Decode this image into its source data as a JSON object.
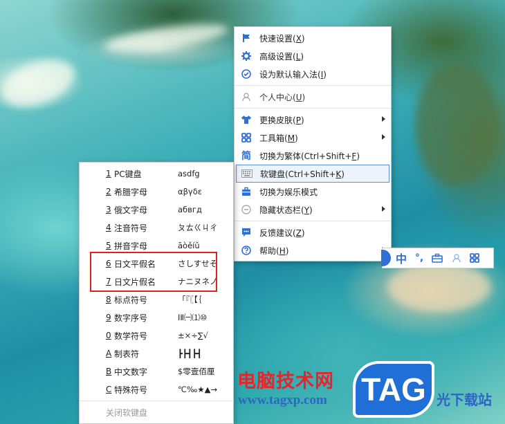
{
  "context_menu": {
    "items": [
      {
        "label": "快速设置(",
        "key": "X",
        "tail": ")",
        "icon": "flag-icon",
        "submenu": false
      },
      {
        "label": "高级设置(",
        "key": "L",
        "tail": ")",
        "icon": "gear-icon",
        "submenu": false
      },
      {
        "label": "设为默认输入法(",
        "key": "I",
        "tail": ")",
        "icon": "check-circle-icon",
        "submenu": false
      },
      {
        "label": "个人中心(",
        "key": "U",
        "tail": ")",
        "icon": "user-icon",
        "submenu": false
      },
      {
        "label": "更换皮肤(",
        "key": "P",
        "tail": ")",
        "icon": "shirt-icon",
        "submenu": true
      },
      {
        "label": "工具箱(",
        "key": "M",
        "tail": ")",
        "icon": "grid-icon",
        "submenu": true
      },
      {
        "label": "切换为繁体(Ctrl+Shift+",
        "key": "F",
        "tail": ")",
        "icon": "traditional-char-icon",
        "icon_text": "简",
        "submenu": false
      },
      {
        "label": "软键盘(Ctrl+Shift+",
        "key": "K",
        "tail": ")",
        "icon": "keyboard-icon",
        "submenu": false,
        "selected": true
      },
      {
        "label": "切换为娱乐模式",
        "key": "",
        "tail": "",
        "icon": "briefcase-icon",
        "submenu": false
      },
      {
        "label": "隐藏状态栏(",
        "key": "Y",
        "tail": ")",
        "icon": "minus-circle-icon",
        "submenu": true
      },
      {
        "label": "反馈建议(",
        "key": "Z",
        "tail": ")",
        "icon": "chat-icon",
        "submenu": false
      },
      {
        "label": "帮助(",
        "key": "H",
        "tail": ")",
        "icon": "question-icon",
        "submenu": true
      }
    ]
  },
  "soft_keyboard_menu": {
    "items": [
      {
        "num": "1",
        "name": "PC键盘",
        "sample": "asdfg"
      },
      {
        "num": "2",
        "name": "希腊字母",
        "sample": "αβγδε"
      },
      {
        "num": "3",
        "name": "俄文字母",
        "sample": "абвгд"
      },
      {
        "num": "4",
        "name": "注音符号",
        "sample": "ㄆㄊㄍㄐㄔ"
      },
      {
        "num": "5",
        "name": "拼音字母",
        "sample": "āòěíǔ"
      },
      {
        "num": "6",
        "name": "日文平假名",
        "sample": "さしすせそ"
      },
      {
        "num": "7",
        "name": "日文片假名",
        "sample": "ナニヌネノ"
      },
      {
        "num": "8",
        "name": "标点符号",
        "sample": "「『〖【｛"
      },
      {
        "num": "9",
        "name": "数字序号",
        "sample": "ⅠⅡ㈠⑴⑩"
      },
      {
        "num": "0",
        "name": "数学符号",
        "sample": "±×÷∑√"
      },
      {
        "num": "A",
        "name": "制表符",
        "sample": "┣┣┫┣┫"
      },
      {
        "num": "B",
        "name": "中文数字",
        "sample": "$零壹佰厘"
      },
      {
        "num": "C",
        "name": "特殊符号",
        "sample": "℃‰★▲→"
      }
    ],
    "close_label": "关闭软键盘"
  },
  "ime_bar": {
    "mode": "中",
    "punct": "°,"
  },
  "watermark": {
    "title": "电脑技术网",
    "url": "www.tagxp.com",
    "tag": "TAG",
    "site": "光下载站"
  },
  "colors": {
    "accent": "#2f6fd6",
    "highlight": "#e02020",
    "selected_bg": "#eef4fc"
  }
}
